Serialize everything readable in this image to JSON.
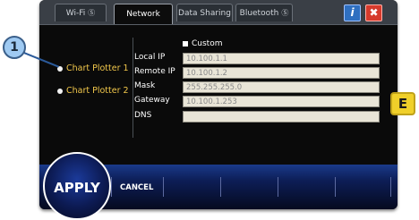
{
  "tabs": [
    {
      "label": "Wi-Fi",
      "indicator": "Ⓢ",
      "active": false
    },
    {
      "label": "Network",
      "indicator": "",
      "active": true
    },
    {
      "label": "Data Sharing",
      "indicator": "",
      "active": false
    },
    {
      "label": "Bluetooth",
      "indicator": "Ⓢ",
      "active": false
    }
  ],
  "toolbar": {
    "help_icon": "i",
    "close_icon": "✖"
  },
  "devices": [
    {
      "label": "Chart Plotter 1",
      "selected": true
    },
    {
      "label": "Chart Plotter 2",
      "selected": false
    }
  ],
  "custom_label": "Custom",
  "fields": [
    {
      "label": "Local IP",
      "value": "10.100.1.1"
    },
    {
      "label": "Remote IP",
      "value": "10.100.1.2"
    },
    {
      "label": "Mask",
      "value": "255.255.255.0"
    },
    {
      "label": "Gateway",
      "value": "10.100.1.253"
    },
    {
      "label": "DNS",
      "value": ""
    }
  ],
  "bottom": {
    "apply_label": "APPLY",
    "cancel_label": "CANCEL"
  },
  "callouts": {
    "one": "1",
    "e": "E"
  },
  "colors": {
    "device_label": "#f2c84b",
    "field_bg": "#e9e5d7",
    "bar": "#1a3a8a",
    "callout_e": "#f0d02a",
    "callout_1": "#9fcaf2"
  }
}
